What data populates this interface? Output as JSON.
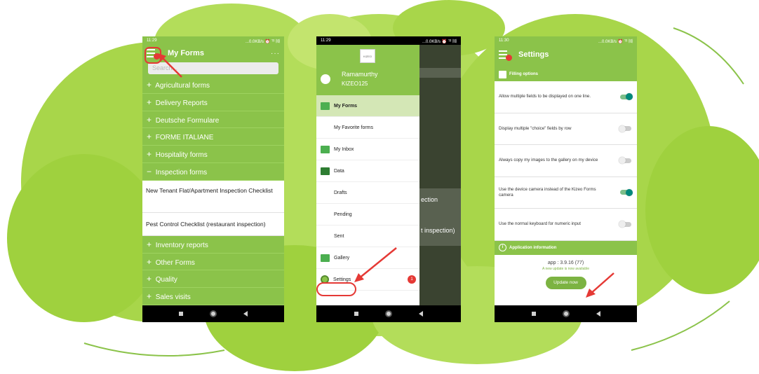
{
  "colors": {
    "accent_green": "#8bc34a",
    "highlight_red": "#e53935",
    "toggle_on": "#00897b"
  },
  "screen1": {
    "status_time": "11:29",
    "status_right": "...0.0KB/s ⏰ ᵀˡˡ ⑽",
    "title": "My Forms",
    "more_label": "···",
    "search_placeholder": "Search...",
    "categories_top": [
      {
        "sign": "+",
        "label": "Agricultural forms"
      },
      {
        "sign": "+",
        "label": "Delivery Reports"
      },
      {
        "sign": "+",
        "label": "Deutsche Formulare"
      },
      {
        "sign": "+",
        "label": "FORME ITALIANE"
      },
      {
        "sign": "+",
        "label": "Hospitality forms"
      },
      {
        "sign": "−",
        "label": "Inspection forms"
      }
    ],
    "forms": [
      {
        "label": "New Tenant Flat/Apartment Inspection Checklist"
      },
      {
        "label": "Pest Control Checklist (restaurant inspection)"
      }
    ],
    "categories_bottom": [
      {
        "sign": "+",
        "label": "Inventory reports"
      },
      {
        "sign": "+",
        "label": "Other Forms"
      },
      {
        "sign": "+",
        "label": "Quality"
      },
      {
        "sign": "+",
        "label": "Sales visits"
      }
    ]
  },
  "screen2": {
    "status_time": "11:29",
    "status_right": "...0.0KB/s ⏰ ᵀˡˡ ⑽",
    "logo_text": "KIZEO",
    "user_name": "Ramamurthy",
    "user_id": "KIZEO125",
    "behind_text_1": "ection",
    "behind_text_2": "t inspection)",
    "items": {
      "my_forms": "My Forms",
      "favorite_forms": "My Favorite forms",
      "inbox": "My Inbox",
      "data": "Data",
      "drafts": "Drafts",
      "pending": "Pending",
      "sent": "Sent",
      "gallery": "Gallery",
      "settings": "Settings"
    },
    "settings_badge": "1"
  },
  "screen3": {
    "status_time": "11:30",
    "status_right": "...0.0KB/s ⏰ ᵀˡˡ ⑽",
    "title": "Settings",
    "filling_header": "Filling options",
    "options": [
      {
        "label": "Allow multiple fields to be displayed on one line.",
        "on": true
      },
      {
        "label": "Display multiple \"choice\" fields by row",
        "on": false
      },
      {
        "label": "Always copy my images to the gallery on my device",
        "on": false
      },
      {
        "label": "Use the device camera instead of the Kizeo Forms camera",
        "on": true
      },
      {
        "label": "Use the normal keyboard for numeric input",
        "on": false
      }
    ],
    "info_header": "Application information",
    "version": "app : 3.9.16 (77)",
    "update_note": "A new update is now available",
    "update_button": "Update now"
  }
}
